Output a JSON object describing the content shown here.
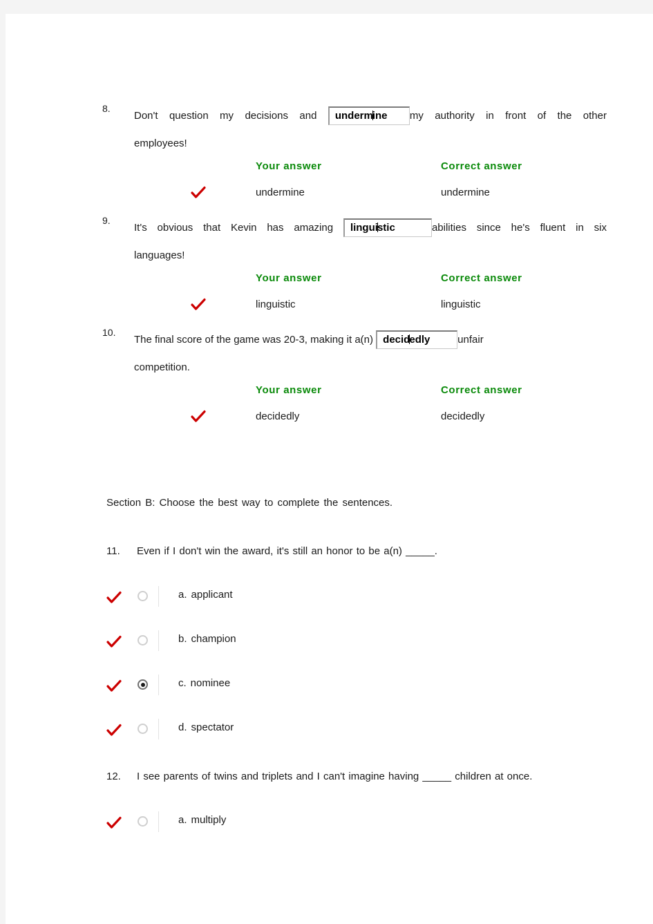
{
  "colors": {
    "page_bg": "#ffffff",
    "canvas_bg": "#f4f4f4",
    "answer_header_green": "#0a8a0a",
    "tick_red": "#cc0000",
    "text": "#1a1a1a"
  },
  "labels": {
    "your_answer": "Your answer",
    "correct_answer": "Correct answer"
  },
  "fill_questions": [
    {
      "number": "8.",
      "text_before": "Don't question my decisions and",
      "input_value": "undermine",
      "input_caret_after": 6,
      "text_after": "my authority in front of the other",
      "text_line2": "employees!",
      "your_answer": "undermine",
      "correct_answer": "undermine",
      "tick": "check-icon"
    },
    {
      "number": "9.",
      "text_before": "It's obvious that Kevin has amazing",
      "input_value": "linguistic",
      "input_caret_after": 6,
      "text_after": "abilities since he's fluent in six",
      "text_line2": "languages!",
      "your_answer": "linguistic",
      "correct_answer": "linguistic",
      "tick": "check-icon"
    },
    {
      "number": "10.",
      "text_before": "The final score of the game was 20-3, making it a(n)",
      "input_value": "decidedly",
      "input_caret_after": 5,
      "text_after": "unfair",
      "text_line2": "competition.",
      "your_answer": "decidedly",
      "correct_answer": "decidedly",
      "tick": "check-icon"
    }
  ],
  "section_b": {
    "heading": "Section B: Choose the best way to complete the sentences.",
    "questions": [
      {
        "number": "11.",
        "text": "Even if I don't win the award, it's still an honor to be a(n) _____.",
        "options": [
          {
            "letter": "a.",
            "label": "applicant",
            "selected": false,
            "tick": "check-icon"
          },
          {
            "letter": "b.",
            "label": "champion",
            "selected": false,
            "tick": "check-icon"
          },
          {
            "letter": "c.",
            "label": "nominee",
            "selected": true,
            "tick": "check-icon"
          },
          {
            "letter": "d.",
            "label": "spectator",
            "selected": false,
            "tick": "check-icon"
          }
        ]
      },
      {
        "number": "12.",
        "text": "I see parents of twins and triplets and I can't imagine having _____ children at once.",
        "options": [
          {
            "letter": "a.",
            "label": "multiply",
            "selected": false,
            "tick": "check-icon"
          }
        ]
      }
    ]
  }
}
